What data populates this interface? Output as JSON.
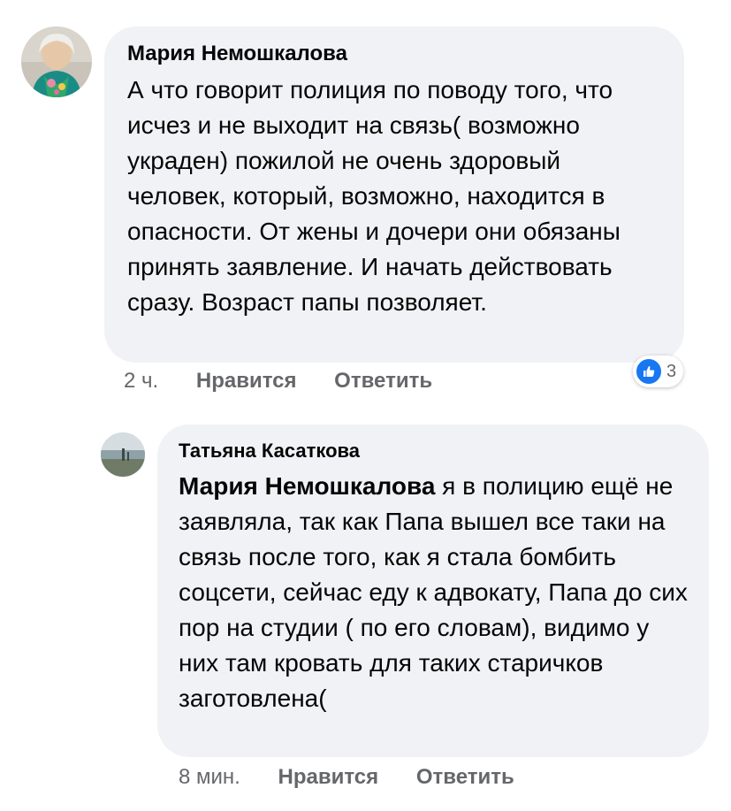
{
  "comments": [
    {
      "author": "Мария Немошкалова",
      "text": "А что говорит полиция по поводу того, что исчез и не выходит на связь( возможно украден) пожилой не очень здоровый человек, который, возможно, находится в опасности. От жены и дочери они обязаны принять заявление. И начать действовать сразу. Возраст папы позволяет.",
      "time": "2 ч.",
      "like_label": "Нравится",
      "reply_label": "Ответить",
      "reaction_count": "3",
      "reaction_icon": "like-icon"
    },
    {
      "author": "Татьяна Касаткова",
      "mention": "Мария Немошкалова",
      "text": " я в полицию ещё не заявляла, так как Папа вышел все таки на связь после того, как я стала бомбить соцсети, сейчас еду к адвокату, Папа до сих пор на студии ( по его словам), видимо у них там кровать для таких старичков заготовлена(",
      "time": "8 мин.",
      "like_label": "Нравится",
      "reply_label": "Ответить"
    }
  ],
  "colors": {
    "bubble": "#f0f2f5",
    "meta_text": "#65676b",
    "like_blue": "#1877f2"
  }
}
